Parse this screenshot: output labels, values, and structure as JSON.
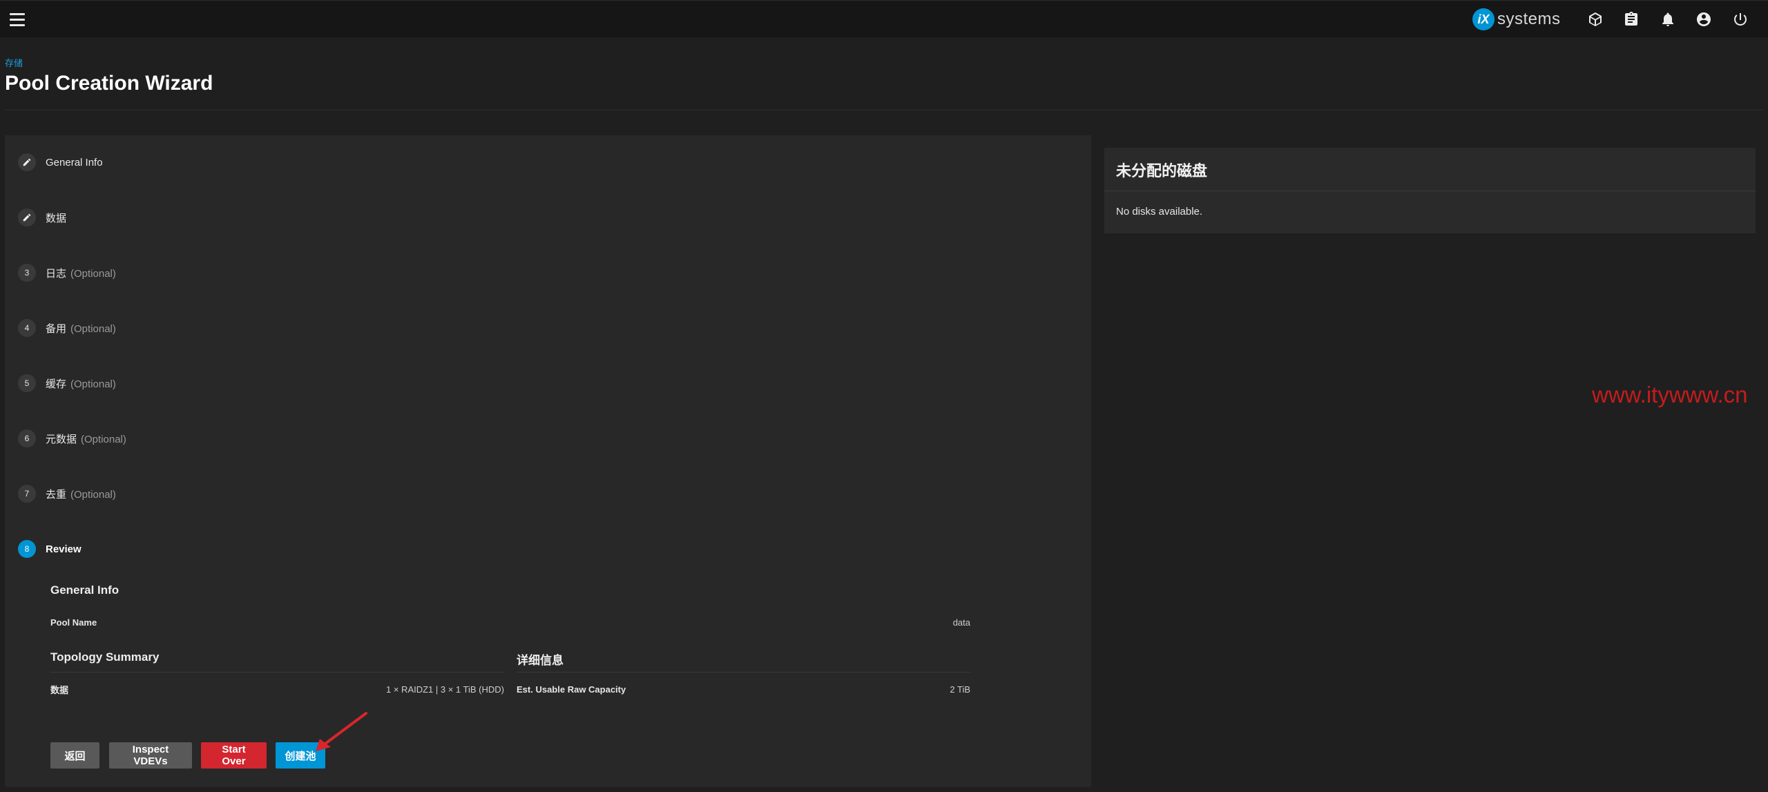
{
  "topbar": {
    "brand_mark": "iX",
    "brand_text": "systems",
    "icons": [
      "menu-icon",
      "truecommand-icon",
      "clipboard-icon",
      "bell-icon",
      "account-icon",
      "power-icon"
    ]
  },
  "header": {
    "breadcrumb": "存储",
    "title": "Pool Creation Wizard"
  },
  "wizard": {
    "steps": [
      {
        "badge": "",
        "icon": "pencil-icon",
        "label": "General Info",
        "optional": ""
      },
      {
        "badge": "",
        "icon": "pencil-icon",
        "label": "数据",
        "optional": ""
      },
      {
        "badge": "3",
        "label": "日志",
        "optional": "(Optional)"
      },
      {
        "badge": "4",
        "label": "备用",
        "optional": "(Optional)"
      },
      {
        "badge": "5",
        "label": "缓存",
        "optional": "(Optional)"
      },
      {
        "badge": "6",
        "label": "元数据",
        "optional": "(Optional)"
      },
      {
        "badge": "7",
        "label": "去重",
        "optional": "(Optional)"
      },
      {
        "badge": "8",
        "label": "Review",
        "optional": "",
        "active": true
      }
    ],
    "review": {
      "general_info_heading": "General Info",
      "pool_name_label": "Pool Name",
      "pool_name_value": "data",
      "topology_heading": "Topology Summary",
      "topology_data_label": "数据",
      "topology_data_value": "1 × RAIDZ1 | 3 × 1 TiB (HDD)",
      "details_heading": "详细信息",
      "capacity_label": "Est. Usable Raw Capacity",
      "capacity_value": "2 TiB"
    },
    "buttons": {
      "back": "返回",
      "inspect": "Inspect VDEVs",
      "start_over": "Start Over",
      "create": "创建池"
    }
  },
  "unassigned_disks": {
    "title": "未分配的磁盘",
    "empty_text": "No disks available."
  },
  "watermark": "www.itywww.cn",
  "colors": {
    "accent": "#0095d5",
    "danger": "#d3262f",
    "annotation": "#d9262a"
  }
}
